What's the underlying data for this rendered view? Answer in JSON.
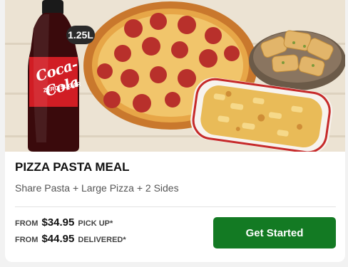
{
  "card": {
    "bottle_size": "1.25L",
    "bottle_brand": "Coca-Cola",
    "bottle_sub": "ZERO SUGAR",
    "title": "PIZZA PASTA MEAL",
    "subtitle": "Share Pasta + Large Pizza + 2 Sides",
    "pickup": {
      "prefix": "FROM",
      "amount": "$34.95",
      "suffix": "PICK UP*"
    },
    "delivered": {
      "prefix": "FROM",
      "amount": "$44.95",
      "suffix": "DELIVERED*"
    },
    "cta_label": "Get Started",
    "colors": {
      "cta": "#137a23"
    }
  }
}
